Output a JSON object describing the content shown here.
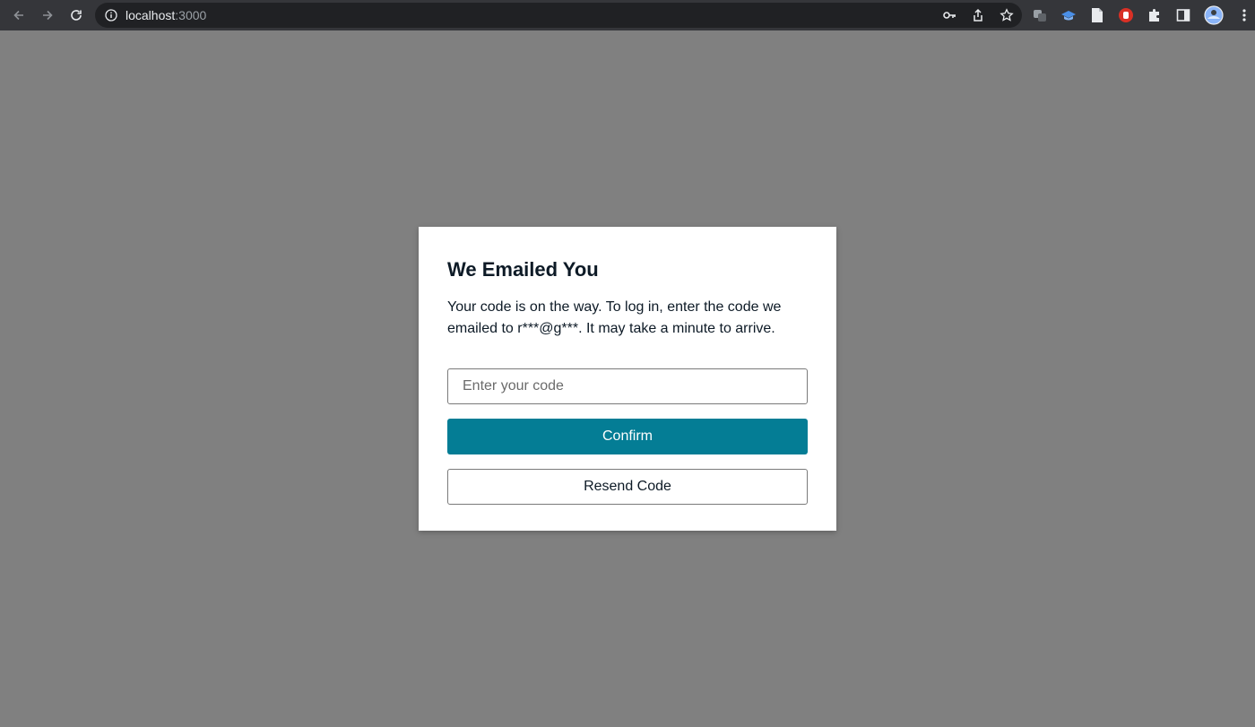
{
  "browser": {
    "url_host": "localhost",
    "url_port": ":3000",
    "icons": {
      "back": "arrow-left-icon",
      "forward": "arrow-right-icon",
      "reload": "reload-icon",
      "info": "info-icon",
      "key": "key-icon",
      "share": "share-icon",
      "bookmark": "star-icon",
      "extensions": "puzzle-icon",
      "side_panel": "side-panel-icon",
      "menu": "kebab-menu-icon"
    }
  },
  "dialog": {
    "title": "We Emailed You",
    "message": "Your code is on the way. To log in, enter the code we emailed to r***@g***. It may take a minute to arrive.",
    "code_placeholder": "Enter your code",
    "code_value": "",
    "confirm_label": "Confirm",
    "resend_label": "Resend Code"
  },
  "colors": {
    "backdrop": "#808080",
    "primary_button": "#047d95",
    "chrome_bar": "#35363a"
  }
}
